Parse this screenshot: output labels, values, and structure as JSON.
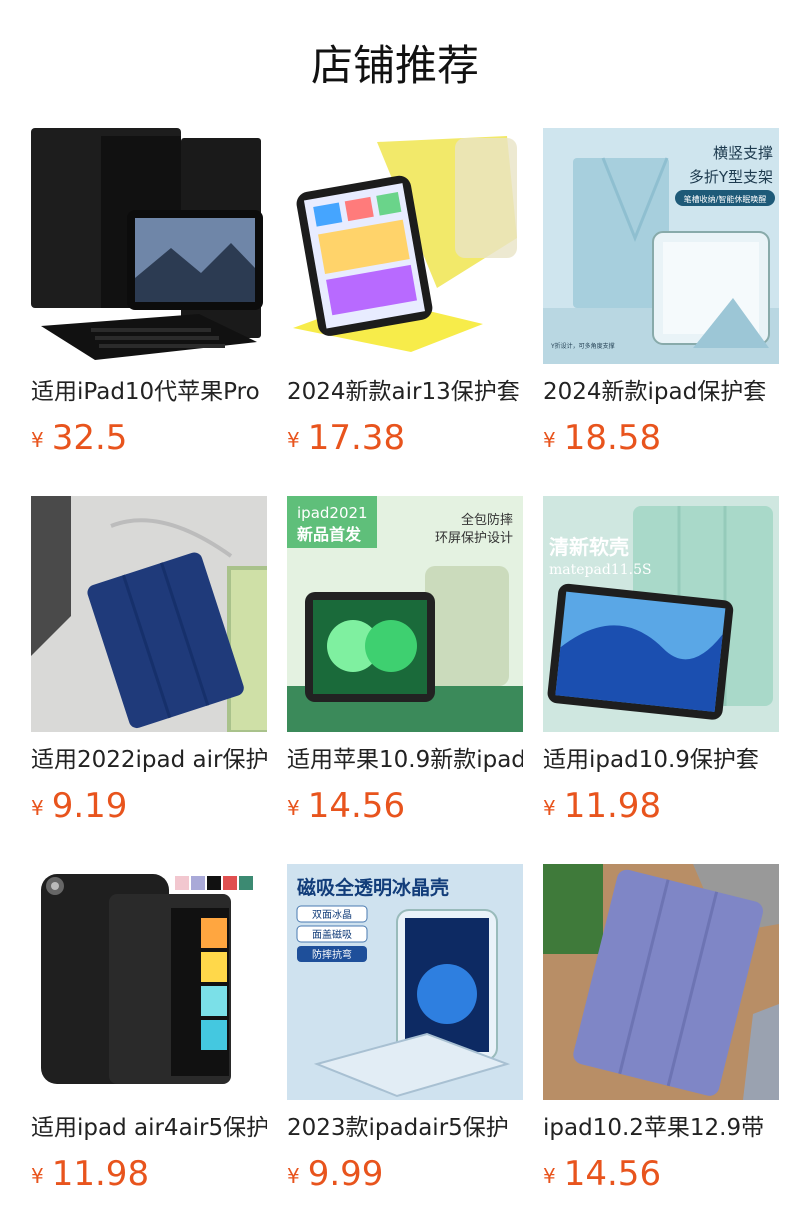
{
  "section": {
    "title": "店铺推荐"
  },
  "products": [
    {
      "name": "适用iPad10代苹果Pro",
      "currency": "¥",
      "price": "32.5",
      "image": "black-keyboard-case"
    },
    {
      "name": "2024新款air13保护套",
      "currency": "¥",
      "price": "17.38",
      "image": "yellow-rotating-case"
    },
    {
      "name": "2024新款ipad保护套",
      "currency": "¥",
      "price": "18.58",
      "image": "blue-y-fold-case",
      "overlay": [
        "横竖支撑",
        "多折Y型支架",
        "笔槽收纳/智能休眠唤醒",
        "Y折设计，可多角度支撑"
      ]
    },
    {
      "name": "适用2022ipad air保护",
      "currency": "¥",
      "price": "9.19",
      "image": "navy-trifold-case"
    },
    {
      "name": "适用苹果10.9新款ipad",
      "currency": "¥",
      "price": "14.56",
      "image": "green-clear-case",
      "overlay": [
        "ipad2021",
        "新品首发",
        "全包防摔",
        "环屏保护设计"
      ]
    },
    {
      "name": "适用ipad10.9保护套",
      "currency": "¥",
      "price": "11.98",
      "image": "mint-soft-case",
      "overlay": [
        "清新软壳",
        "matepad11.5S"
      ]
    },
    {
      "name": "适用ipad air4air5保护",
      "currency": "¥",
      "price": "11.98",
      "image": "black-mini-case"
    },
    {
      "name": "2023款ipadair5保护",
      "currency": "¥",
      "price": "9.99",
      "image": "clear-ice-case",
      "overlay": [
        "磁吸全透明冰晶壳",
        "双面冰晶",
        "面盖磁吸",
        "防摔抗弯"
      ]
    },
    {
      "name": "ipad10.2苹果12.9带",
      "currency": "¥",
      "price": "14.56",
      "image": "lavender-trifold-case"
    }
  ]
}
